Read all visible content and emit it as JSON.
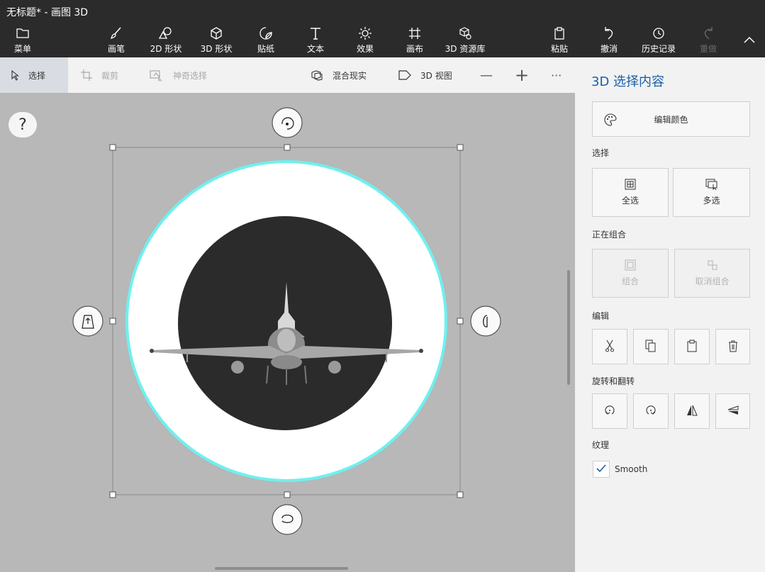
{
  "window": {
    "title": "无标题* - 画图 3D"
  },
  "toolbar": {
    "menu": "菜单",
    "brushes": "画笔",
    "shapes2d": "2D 形状",
    "shapes3d": "3D 形状",
    "stickers": "贴纸",
    "text": "文本",
    "effects": "效果",
    "canvas": "画布",
    "library3d": "3D 资源库",
    "paste": "粘贴",
    "undo": "撤消",
    "history": "历史记录",
    "redo": "重做"
  },
  "subtoolbar": {
    "select": "选择",
    "crop": "裁剪",
    "magic_select": "神奇选择",
    "mixed_reality": "混合现实",
    "view3d": "3D 视图",
    "zoom_out": "—",
    "zoom_in": "+",
    "more": "···"
  },
  "canvas": {
    "help": "?"
  },
  "panel": {
    "title": "3D 选择内容",
    "edit_color": "编辑颜色",
    "section_select": "选择",
    "select_all": "全选",
    "multi_select": "多选",
    "section_group": "正在组合",
    "group": "组合",
    "ungroup": "取消组合",
    "section_edit": "编辑",
    "section_rotate": "旋转和翻转",
    "section_texture": "纹理",
    "smooth": "Smooth",
    "smooth_checked": true
  },
  "colors": {
    "accent": "#1a5fa8",
    "selection_glow": "#6ff0f0",
    "topbar": "#2b2b2b"
  }
}
